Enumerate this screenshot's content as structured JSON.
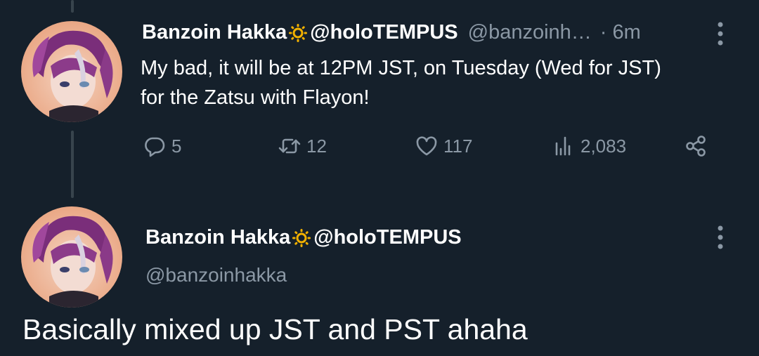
{
  "tweet1": {
    "display_name": "Banzoin Hakka",
    "name_suffix": "@holoTEMPUS",
    "handle": "@banzoinh…",
    "separator": "·",
    "time": "6m",
    "text_line1": "My bad, it will be at 12PM JST, on Tuesday (Wed for JST)",
    "text_line2": "for the Zatsu with Flayon!",
    "replies": "5",
    "retweets": "12",
    "likes": "117",
    "views": "2,083"
  },
  "tweet2": {
    "display_name": "Banzoin Hakka",
    "name_suffix": "@holoTEMPUS",
    "handle": "@banzoinhakka",
    "text": "Basically mixed up JST and PST ahaha"
  },
  "colors": {
    "background": "#15202b",
    "secondary_text": "#8b98a5",
    "badge": "#f2b100",
    "thread_line": "#38444d"
  }
}
